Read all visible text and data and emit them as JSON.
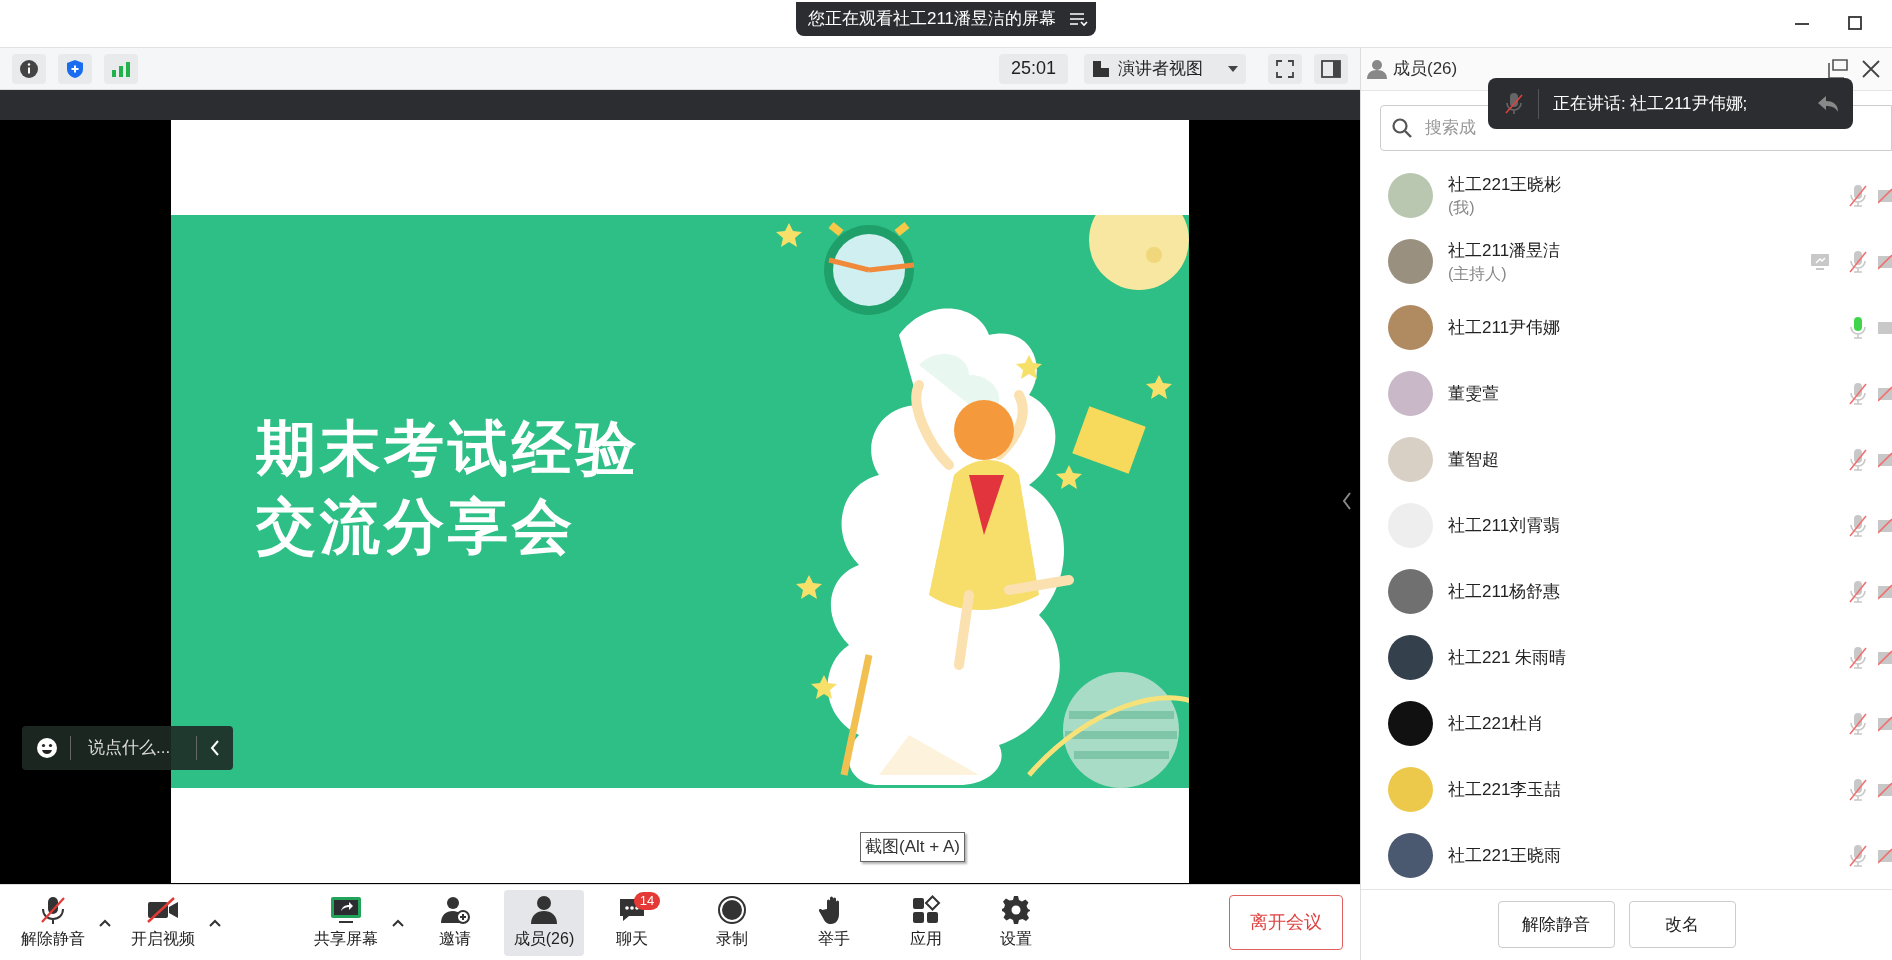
{
  "window": {
    "banner": "您正在观看社工211潘昱洁的屏幕"
  },
  "top_toolbar": {
    "timer": "25:01",
    "view_mode": "演讲者视图"
  },
  "slide": {
    "title_lines": [
      "期末考试经验",
      "交流分享会"
    ]
  },
  "comment_bar": {
    "placeholder": "说点什么..."
  },
  "tooltip": "截图(Alt + A)",
  "bottom_toolbar": [
    {
      "kind": "mic_off",
      "label": "解除静音",
      "has_menu": true,
      "selected": false
    },
    {
      "kind": "video_off",
      "label": "开启视频",
      "has_menu": true,
      "selected": false
    },
    {
      "kind": "share",
      "label": "共享屏幕",
      "has_menu": true,
      "selected": false
    },
    {
      "kind": "invite",
      "label": "邀请",
      "has_menu": false,
      "selected": false
    },
    {
      "kind": "members",
      "label": "成员(26)",
      "has_menu": false,
      "selected": true
    },
    {
      "kind": "chat",
      "label": "聊天",
      "has_menu": false,
      "selected": false,
      "badge": "14"
    },
    {
      "kind": "record",
      "label": "录制",
      "has_menu": false,
      "selected": false
    },
    {
      "kind": "raise_hand",
      "label": "举手",
      "has_menu": false,
      "selected": false
    },
    {
      "kind": "apps",
      "label": "应用",
      "has_menu": false,
      "selected": false
    },
    {
      "kind": "settings",
      "label": "设置",
      "has_menu": false,
      "selected": false
    }
  ],
  "leave_button": "离开会议",
  "members_panel": {
    "title": "成员(26)",
    "search": {
      "placeholder": "搜索成"
    },
    "speaking_toast": "正在讲话: 社工211尹伟娜;",
    "members": [
      {
        "name": "社工221王晓彬",
        "role": "(我)",
        "muted": true,
        "video_off": true,
        "sharing": false
      },
      {
        "name": "社工211潘昱洁",
        "role": "(主持人)",
        "muted": true,
        "video_off": true,
        "sharing": true
      },
      {
        "name": "社工211尹伟娜",
        "muted": false,
        "video_off": false,
        "sharing": false
      },
      {
        "name": "董雯萱",
        "muted": true,
        "video_off": true,
        "sharing": false
      },
      {
        "name": "董智超",
        "muted": true,
        "video_off": true,
        "sharing": false
      },
      {
        "name": "社工211刘霄翡",
        "muted": true,
        "video_off": true,
        "sharing": false
      },
      {
        "name": "社工211杨舒惠",
        "muted": true,
        "video_off": true,
        "sharing": false
      },
      {
        "name": "社工221 朱雨晴",
        "muted": true,
        "video_off": true,
        "sharing": false
      },
      {
        "name": "社工221杜肖",
        "muted": true,
        "video_off": true,
        "sharing": false
      },
      {
        "name": "社工221李玉喆",
        "muted": true,
        "video_off": true,
        "sharing": false
      },
      {
        "name": "社工221王晓雨",
        "muted": true,
        "video_off": true,
        "sharing": false
      }
    ],
    "buttons": [
      "解除静音",
      "改名"
    ]
  }
}
